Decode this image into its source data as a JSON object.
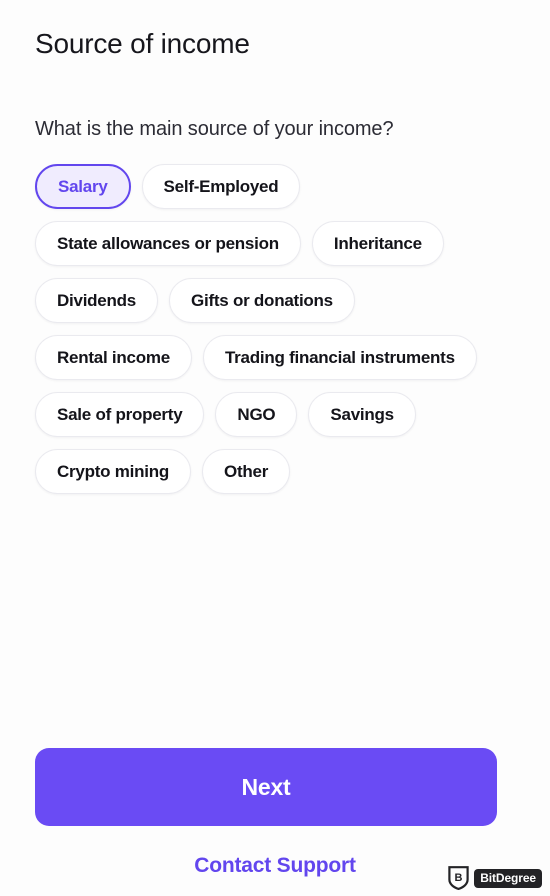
{
  "header": {
    "title": "Source of income",
    "question": "What is the main source of your income?"
  },
  "income_sources": {
    "selected": "Salary",
    "options": [
      {
        "label": "Salary",
        "selected": true
      },
      {
        "label": "Self-Employed",
        "selected": false
      },
      {
        "label": "State allowances or pension",
        "selected": false
      },
      {
        "label": "Inheritance",
        "selected": false
      },
      {
        "label": "Dividends",
        "selected": false
      },
      {
        "label": "Gifts or donations",
        "selected": false
      },
      {
        "label": "Rental income",
        "selected": false
      },
      {
        "label": "Trading financial instruments",
        "selected": false
      },
      {
        "label": "Sale of property",
        "selected": false
      },
      {
        "label": "NGO",
        "selected": false
      },
      {
        "label": "Savings",
        "selected": false
      },
      {
        "label": "Crypto mining",
        "selected": false
      },
      {
        "label": "Other",
        "selected": false
      }
    ]
  },
  "footer": {
    "next_label": "Next",
    "support_label": "Contact Support"
  },
  "watermark": {
    "brand": "BitDegree",
    "icon": "shield-b-icon"
  },
  "colors": {
    "accent": "#6A4BF4",
    "accent_text": "#6246EE",
    "chip_selected_bg": "#F0ECFE",
    "chip_border": "#EAEAEF",
    "page_bg": "#FDFDFD",
    "text_primary": "#16161C"
  }
}
